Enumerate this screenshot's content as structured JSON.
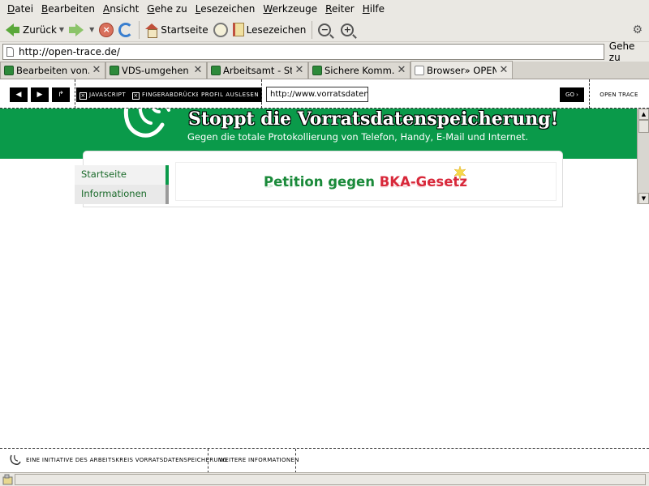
{
  "menu": [
    "Datei",
    "Bearbeiten",
    "Ansicht",
    "Gehe zu",
    "Lesezeichen",
    "Werkzeuge",
    "Reiter",
    "Hilfe"
  ],
  "toolbar": {
    "back_label": "Zurück",
    "home_label": "Startseite",
    "bookmarks_label": "Lesezeichen"
  },
  "location": {
    "url": "http://open-trace.de/",
    "go_label": "Gehe zu"
  },
  "tabs": [
    {
      "label": "Bearbeiten von..."
    },
    {
      "label": "VDS-umgehen ..."
    },
    {
      "label": "Arbeitsamt - St..."
    },
    {
      "label": "Sichere Komm..."
    },
    {
      "label": "Browser» OPEN..."
    }
  ],
  "opentrace": {
    "btn_back": "◀",
    "btn_forward": "▶",
    "btn_reload": "↱",
    "javascript": "Javascript",
    "fingerprints": "Fingerabdrücke",
    "read_profile": "Profil auslesen",
    "url": "http://www.vorratsdatensp",
    "go": "GO ›",
    "logo": "OPEN TRACE",
    "footer_initiative": "Eine Initiative des Arbeitskreis Vorratsdatenspeicherung",
    "footer_more": "Weitere Informationen"
  },
  "site": {
    "title": "Stoppt die Vorratsdatenspeicherung!",
    "subtitle": "Gegen die totale Protokollierung von Telefon, Handy, E-Mail und Internet.",
    "sidebar": [
      "Startseite",
      "Informationen"
    ],
    "petition_green": "Petition gegen ",
    "petition_red": "BKA-Gesetz"
  },
  "colors": {
    "banner_green": "#0a9a4a",
    "petition_green": "#1a8a3a",
    "petition_red": "#d8283a"
  }
}
